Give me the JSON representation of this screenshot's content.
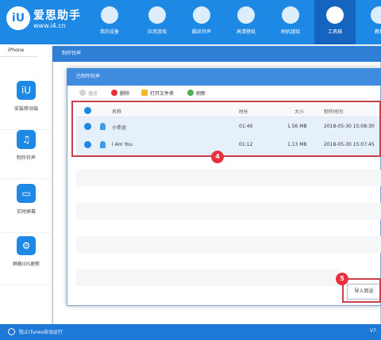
{
  "app": {
    "name": "爱思助手",
    "url": "www.i4.cn"
  },
  "topnav": [
    {
      "label": "我的设备",
      "icon": "apple-icon"
    },
    {
      "label": "应用游戏",
      "icon": "app-store-icon"
    },
    {
      "label": "酷炫铃声",
      "icon": "bell-icon"
    },
    {
      "label": "高清壁纸",
      "icon": "flower-icon"
    },
    {
      "label": "刷机越狱",
      "icon": "box-icon"
    },
    {
      "label": "工具箱",
      "icon": "tools-icon"
    },
    {
      "label": "教程",
      "icon": "book-icon"
    }
  ],
  "sidebar": {
    "tab": "iPhone",
    "items": [
      {
        "label": "安装移动端",
        "icon": "i4-icon"
      },
      {
        "label": "制作铃声",
        "icon": "bell-icon"
      },
      {
        "label": "实时屏幕",
        "icon": "monitor-icon"
      },
      {
        "label": "屏蔽iOS更新",
        "icon": "gear-icon"
      }
    ]
  },
  "outer_dialog": {
    "title": "制作铃声"
  },
  "inner_dialog": {
    "title": "已制作铃声",
    "toolbar": {
      "play": "播放",
      "delete": "删除",
      "open_folder": "打开文件夹",
      "refresh": "刷新"
    },
    "columns": [
      "名称",
      "时长",
      "大小",
      "制作时间"
    ],
    "rows": [
      {
        "name": "小幸运",
        "duration": "01:40",
        "size": "1.56 MB",
        "time": "2018-05-30 15:08:30"
      },
      {
        "name": "I Am You",
        "duration": "01:12",
        "size": "1.13 MB",
        "time": "2018-05-30 15:07:45"
      }
    ],
    "import_button": "导入到设"
  },
  "annotations": {
    "step4": "4",
    "step5": "5"
  },
  "statusbar": {
    "text": "阻止iTunes自动运行",
    "version": "V7."
  },
  "colors": {
    "primary": "#1e88e5",
    "header_dark": "#1565c0",
    "annotation_red": "#e8313d",
    "highlight_border": "#c93f4e"
  }
}
